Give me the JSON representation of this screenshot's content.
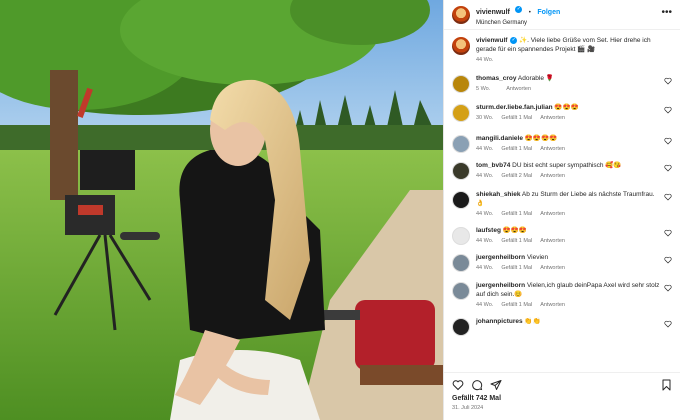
{
  "post": {
    "username": "vivienwulf",
    "follow_label": "Folgen",
    "location": "München Germany",
    "caption_text": ". Viele liebe Grüße vom Set. Hier drehe ich gerade für ein spannendes Projekt 🎬 🎥",
    "caption_time": "44 Wo.",
    "likes": "Gefällt 742 Mal",
    "date": "31. Juli 2024"
  },
  "labels": {
    "reply": "Antworten"
  },
  "comments": [
    {
      "user": "thomas_croy",
      "text": "Adorable 🌹",
      "time": "5 Wo.",
      "likes": "",
      "avatar_color": "#b8860b"
    },
    {
      "user": "sturm.der.liebe.fan.julian",
      "text": "😍😍😍",
      "time": "30 Wo.",
      "likes": "Gefällt 1 Mal",
      "avatar_color": "#d4a017"
    },
    {
      "user": "mangili.daniele",
      "text": "😍😍😍😍",
      "time": "44 Wo.",
      "likes": "Gefällt 1 Mal",
      "avatar_color": "#8aa0b4"
    },
    {
      "user": "tom_bvb74",
      "text": "DU bist echt super sympathisch 🥰😘",
      "time": "44 Wo.",
      "likes": "Gefällt 2 Mal",
      "avatar_color": "#3a3a2a"
    },
    {
      "user": "shiekah_shiek",
      "text": "Ab zu Sturm der Liebe als nächste Traumfrau. 👌",
      "time": "44 Wo.",
      "likes": "Gefällt 1 Mal",
      "avatar_color": "#1a1a1a"
    },
    {
      "user": "laufsteg",
      "text": "😍😍😍",
      "time": "44 Wo.",
      "likes": "Gefällt 1 Mal",
      "avatar_color": "#e8e8e8"
    },
    {
      "user": "juergenheilborn",
      "text": "Vievien",
      "time": "44 Wo.",
      "likes": "Gefällt 1 Mal",
      "avatar_color": "#7a8a98"
    },
    {
      "user": "juergenheilborn",
      "text": "Vielen,ich glaub deinPapa Axel wird sehr stolz auf dich sein.😊",
      "time": "44 Wo.",
      "likes": "Gefällt 1 Mal",
      "avatar_color": "#7a8a98"
    },
    {
      "user": "johannpictures",
      "text": "👏👏",
      "time": "",
      "likes": "",
      "avatar_color": "#222222"
    }
  ],
  "colors": {
    "accent": "#0095f6",
    "meta": "#737373"
  }
}
